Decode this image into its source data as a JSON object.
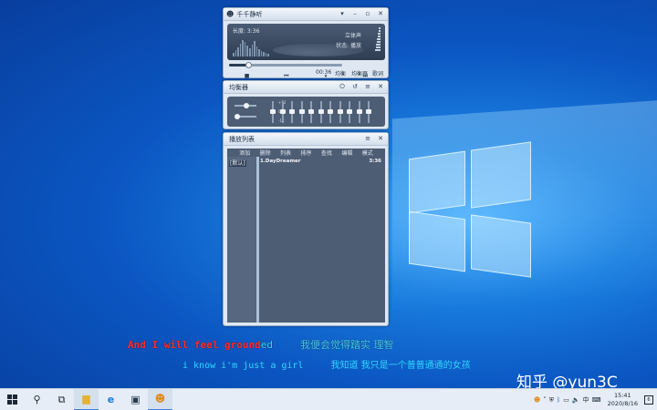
{
  "player": {
    "title": "千千静听",
    "length_label": "长度: 3:36",
    "stereo_label": "立体声",
    "status_label": "状态: 播放",
    "time": "00:36",
    "btn_eq_short": "均衡",
    "btn_eq": "均衡器",
    "btn_lyric": "歌词",
    "progress_fraction": 0.17,
    "transport": [
      "■",
      "⏮",
      "⏸",
      "⏭"
    ]
  },
  "equalizer": {
    "title": "均衡器",
    "scale_top": "+12",
    "scale_mid": "0",
    "scale_bottom": "-12",
    "band_levels": [
      0,
      0,
      0,
      0,
      0,
      0,
      0,
      0,
      0,
      0,
      0
    ]
  },
  "playlist": {
    "title": "播放列表",
    "menu": [
      "添加",
      "删除",
      "列表",
      "排序",
      "查找",
      "编辑",
      "模式"
    ],
    "list_name": "[默认]",
    "items": [
      {
        "title": "1.DayDreamer",
        "duration": "3:36"
      }
    ]
  },
  "lyrics": {
    "line1_sung": "And I will feel ground",
    "line1_rest": "ed",
    "line1_cn": "我便会觉得踏实 理智",
    "line2_en": "i know i'm just a girl",
    "line2_cn": "我知道 我只是一个普普通通的女孩"
  },
  "watermark": "知乎 @yun3C",
  "taskbar": {
    "time": "15:41",
    "date": "2020/8/16",
    "ime": "中",
    "notif_count": "6"
  }
}
